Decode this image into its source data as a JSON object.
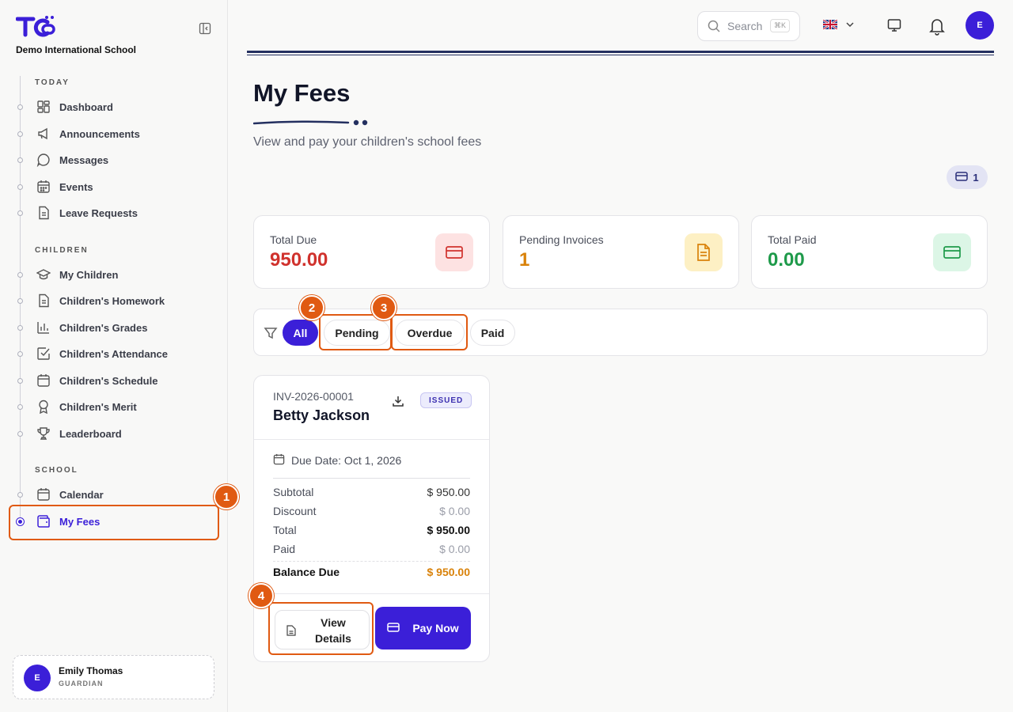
{
  "sidebar": {
    "school_name": "Demo International School",
    "sections": {
      "today": "TODAY",
      "children": "CHILDREN",
      "school": "SCHOOL"
    },
    "items": [
      {
        "label": "Dashboard",
        "icon": "dashboard-icon"
      },
      {
        "label": "Announcements",
        "icon": "megaphone-icon"
      },
      {
        "label": "Messages",
        "icon": "chat-icon"
      },
      {
        "label": "Events",
        "icon": "calendar-grid-icon"
      },
      {
        "label": "Leave Requests",
        "icon": "document-icon"
      },
      {
        "label": "My Children",
        "icon": "graduation-cap-icon"
      },
      {
        "label": "Children's Homework",
        "icon": "document-icon"
      },
      {
        "label": "Children's Grades",
        "icon": "bar-chart-icon"
      },
      {
        "label": "Children's Attendance",
        "icon": "checkbox-icon"
      },
      {
        "label": "Children's Schedule",
        "icon": "calendar-icon"
      },
      {
        "label": "Children's Merit",
        "icon": "ribbon-icon"
      },
      {
        "label": "Leaderboard",
        "icon": "trophy-icon"
      },
      {
        "label": "Calendar",
        "icon": "calendar-icon"
      },
      {
        "label": "My Fees",
        "icon": "wallet-icon",
        "active": true
      }
    ],
    "user": {
      "initial": "E",
      "name": "Emily Thomas",
      "role": "GUARDIAN"
    }
  },
  "header": {
    "search_placeholder": "Search",
    "search_shortcut": "⌘K",
    "language_flag": "🇬🇧",
    "avatar_initial": "E"
  },
  "page": {
    "title": "My Fees",
    "subtitle": "View and pay your children's school fees",
    "invoice_count": "1"
  },
  "stats": [
    {
      "label": "Total Due",
      "value": "950.00",
      "color": "#d0322d",
      "icon_bg": "#fde2e2",
      "icon_color": "#d0322d"
    },
    {
      "label": "Pending Invoices",
      "value": "1",
      "color": "#d9820a",
      "icon_bg": "#fdf0c4",
      "icon_color": "#d9820a"
    },
    {
      "label": "Total Paid",
      "value": "0.00",
      "color": "#1e9a4a",
      "icon_bg": "#dcf6e6",
      "icon_color": "#1e9a4a"
    }
  ],
  "filters": {
    "all": "All",
    "pending": "Pending",
    "overdue": "Overdue",
    "paid": "Paid"
  },
  "invoice": {
    "number": "INV-2026-00001",
    "student": "Betty Jackson",
    "status": "ISSUED",
    "due_date": "Due Date: Oct 1, 2026",
    "subtotal_label": "Subtotal",
    "subtotal": "$ 950.00",
    "discount_label": "Discount",
    "discount": "$ 0.00",
    "total_label": "Total",
    "total": "$ 950.00",
    "paid_label": "Paid",
    "paid": "$ 0.00",
    "balance_label": "Balance Due",
    "balance": "$ 950.00",
    "view_label": "View Details",
    "pay_label": "Pay Now"
  },
  "annotations": [
    "1",
    "2",
    "3",
    "4"
  ],
  "colors": {
    "accent": "#3b1fd8",
    "annotation": "#e05a12"
  }
}
